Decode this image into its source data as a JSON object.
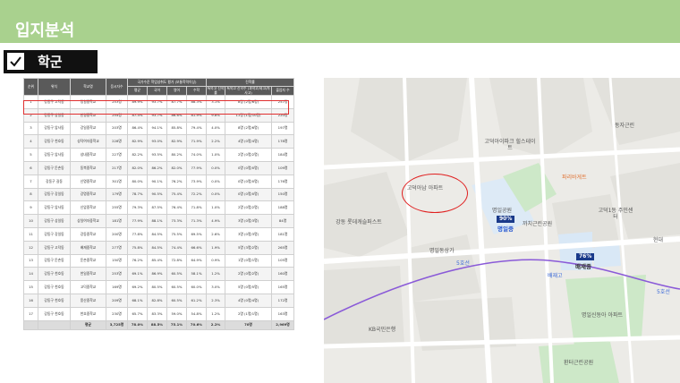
{
  "header": {
    "title": "입지분석"
  },
  "section": {
    "label": "학군"
  },
  "table": {
    "group_headers": {
      "achievement": "국가수준 학업성취도 평가 (보통학력이상)",
      "advance": "진학률"
    },
    "columns": [
      "순위",
      "위치",
      "학교명",
      "응시자수",
      "평균",
      "국어",
      "영어",
      "수학",
      "특목고 진학률",
      "특목고 진학수 (과학고/외고/자사고)",
      "졸업자 수"
    ],
    "rows": [
      [
        "1",
        "강동구 고덕동",
        "명일중학교",
        "253명",
        "89.9%",
        "93.7%",
        "87.7%",
        "88.3%",
        "3.1%",
        "8명 (2명/6명)",
        "257명"
      ],
      [
        "2",
        "강동구 상일동",
        "한영중학교",
        "254명",
        "87.4%",
        "93.7%",
        "86.6%",
        "81.9%",
        "9.8%",
        "11명 (1명/10명)",
        "220명"
      ],
      [
        "3",
        "강동구 암사동",
        "강일중학교",
        "203명",
        "86.4%",
        "94.1%",
        "85.8%",
        "79.4%",
        "4.0%",
        "8명 (2명/6명)",
        "197명"
      ],
      [
        "4",
        "강동구 천호동",
        "성덕여자중학교",
        "228명",
        "82.9%",
        "93.0%",
        "82.9%",
        "71.9%",
        "2.2%",
        "4명 (0명/4명)",
        "178명"
      ],
      [
        "5",
        "강동구 암사동",
        "성내중학교",
        "227명",
        "82.2%",
        "93.5%",
        "80.2%",
        "74.0%",
        "1.0%",
        "2명 (0명/2명)",
        "184명"
      ],
      [
        "6",
        "강동구 둔촌동",
        "동북중학교",
        "217명",
        "82.0%",
        "86.2%",
        "82.0%",
        "77.9%",
        "0.0%",
        "0명 (0명/0명)",
        "109명"
      ],
      [
        "7",
        "강동구 길동",
        "신명중학교",
        "301명",
        "80.0%",
        "90.1%",
        "76.2%",
        "73.9%",
        "0.0%",
        "0명 (0명/0명)",
        "176명"
      ],
      [
        "8",
        "강동구 강일동",
        "강명중학교",
        "179명",
        "78.7%",
        "90.5%",
        "75.4%",
        "72.2%",
        "0.0%",
        "0명 (0명/0명)",
        "150명"
      ],
      [
        "9",
        "강동구 암사동",
        "신암중학교",
        "255명",
        "79.3%",
        "87.5%",
        "76.4%",
        "71.8%",
        "1.0%",
        "2명 (0명/2명)",
        "188명"
      ],
      [
        "10",
        "강동구 상일동",
        "상일여자중학교",
        "181명",
        "77.9%",
        "88.1%",
        "73.3%",
        "71.3%",
        "4.9%",
        "3명 (0명/3명)",
        "84명"
      ],
      [
        "11",
        "강동구 강일동",
        "강동중학교",
        "200명",
        "77.8%",
        "84.5%",
        "75.5%",
        "69.5%",
        "2.6%",
        "3명 (0명/3명)",
        "181명"
      ],
      [
        "12",
        "강동구 고덕동",
        "배재중학교",
        "277명",
        "75.8%",
        "84.5%",
        "74.4%",
        "66.6%",
        "1.9%",
        "5명 (3명/2명)",
        "265명"
      ],
      [
        "13",
        "강동구 둔촌동",
        "둔촌중학교",
        "150명",
        "76.2%",
        "85.4%",
        "72.8%",
        "64.9%",
        "0.9%",
        "1명 (0명/1명)",
        "105명"
      ],
      [
        "14",
        "강동구 천호동",
        "천일중학교",
        "253명",
        "69.1%",
        "86.9%",
        "60.5%",
        "58.1%",
        "1.2%",
        "2명 (0명/2명)",
        "160명"
      ],
      [
        "15",
        "강동구 천호동",
        "고덕중학교",
        "169명",
        "69.2%",
        "80.5%",
        "60.5%",
        "60.0%",
        "3.0%",
        "5명 (0명/5명)",
        "165명"
      ],
      [
        "16",
        "강동구 천호동",
        "풍산중학교",
        "209명",
        "68.1%",
        "82.8%",
        "60.5%",
        "61.2%",
        "2.3%",
        "4명 (0명/4명)",
        "172명"
      ],
      [
        "17",
        "강동구 천호동",
        "천호중학교",
        "230명",
        "65.7%",
        "83.3%",
        "59.0%",
        "54.8%",
        "1.2%",
        "2명 (1명/1명)",
        "163명"
      ]
    ],
    "footer": [
      "",
      "",
      "평균",
      "3,725명",
      "78.0%",
      "88.5%",
      "75.1%",
      "70.6%",
      "2.2%",
      "70명",
      "2,969명"
    ]
  },
  "map": {
    "labels": {
      "dongjagun": "동자근린",
      "godeok_hillstate": "고덕아이파크 힐스테이트",
      "paris": "파리바게트",
      "godeok_ahyeon": "고덕아남 아파트",
      "myeongil_park": "명일공원",
      "kkachi_park": "까치근린공원",
      "godeok1_center": "고덕1동 주민센터",
      "hyundai": "현대",
      "gangdong_lotte": "강동 롯데캐슬퍼스트",
      "myeongil_sangga": "명일동상가",
      "baejae_high": "배재고",
      "line5": "5호선",
      "kb_bank": "KB국민은행",
      "myeongil_sindonga": "명일신동아 아파트",
      "hwanteo_park": "환터근린공원"
    },
    "schools": [
      {
        "name": "명일중",
        "percent": "90%"
      },
      {
        "name": "배재중",
        "percent": "76%"
      }
    ]
  }
}
